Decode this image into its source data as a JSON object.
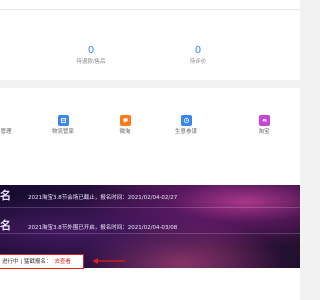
{
  "stats": [
    {
      "value": "0",
      "label": "待退款/售后"
    },
    {
      "value": "0",
      "label": "待评价"
    }
  ],
  "tools": [
    {
      "label": "管理",
      "icon": "manage-icon",
      "color": "#e25454"
    },
    {
      "label": "物流管家",
      "icon": "box-icon",
      "color": "#3a86f7"
    },
    {
      "label": "微淘",
      "icon": "chat-icon",
      "color": "#ff7a1a"
    },
    {
      "label": "生意参谋",
      "icon": "clock-icon",
      "color": "#3a86f7"
    },
    {
      "label": "淘宝",
      "icon": "e-icon",
      "color": "#c547d6"
    }
  ],
  "banner": {
    "side_text_1": "名",
    "side_text_2": "名",
    "line_1": "2021淘宝3.8节会场已截止，报名时间：2021/02/04-02/27",
    "line_2": "2021淘宝3.8节外围已开启，报名时间：2021/02/04-03/08"
  },
  "notice": {
    "status_text": "进行中 | 猛戳报名：",
    "link_text": "去查看"
  },
  "colors": {
    "accent_blue": "#3a86f7",
    "highlight_red": "#e02020"
  }
}
